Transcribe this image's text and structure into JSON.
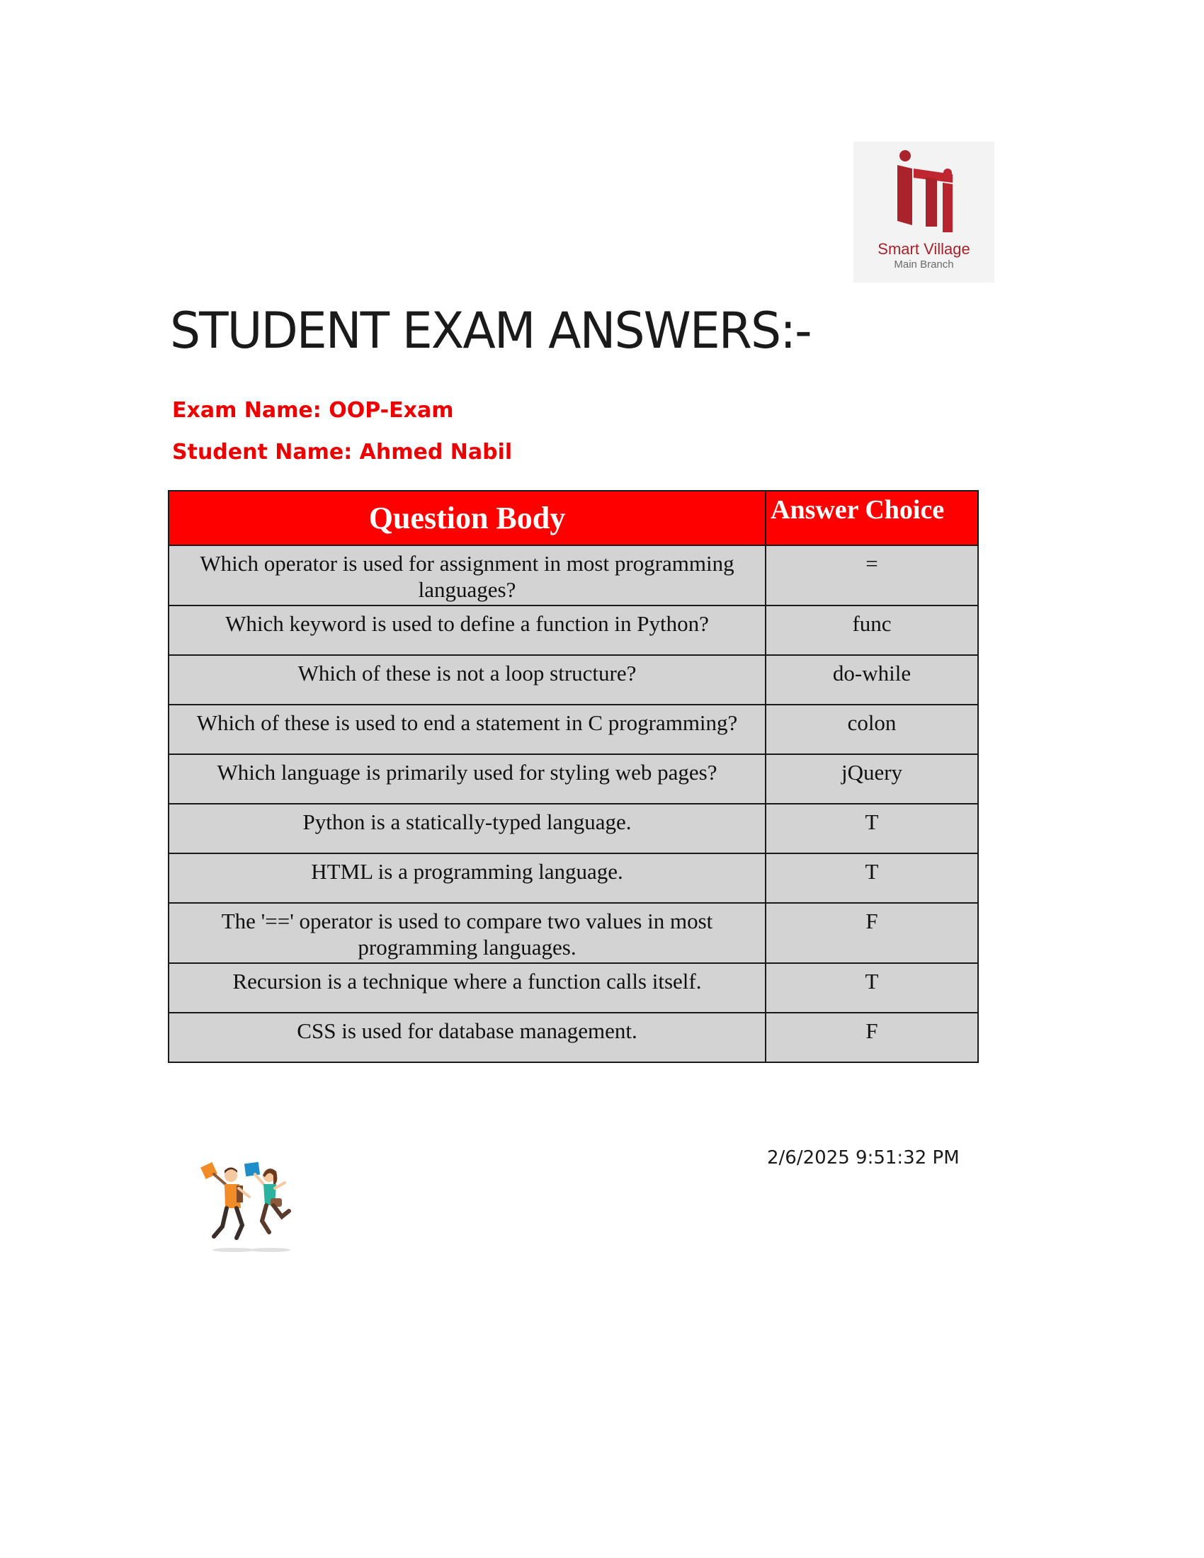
{
  "logo": {
    "title": "Smart Village",
    "subtitle": "Main Branch",
    "brand_color": "#a8232b"
  },
  "title": "STUDENT EXAM ANSWERS:-",
  "exam_name_line": "Exam Name: OOP-Exam",
  "student_name_line": "Student Name: Ahmed Nabil",
  "table": {
    "headers": [
      "Question Body",
      "Answer Choice"
    ],
    "rows": [
      {
        "question": "Which operator is used for assignment in most programming languages?",
        "answer": "="
      },
      {
        "question": "Which keyword is used to define a function in Python?",
        "answer": "func"
      },
      {
        "question": "Which of these is not a loop structure?",
        "answer": "do-while"
      },
      {
        "question": "Which of these is used to end a statement in C programming?",
        "answer": "colon"
      },
      {
        "question": "Which language is primarily used for styling web pages?",
        "answer": "jQuery"
      },
      {
        "question": "Python is a statically-typed language.",
        "answer": "T"
      },
      {
        "question": "HTML is a programming language.",
        "answer": "T"
      },
      {
        "question": "The '==' operator is used to compare two values in most programming languages.",
        "answer": "F"
      },
      {
        "question": "Recursion is a technique where a function calls itself.",
        "answer": "T"
      },
      {
        "question": "CSS is used for database management.",
        "answer": "F"
      }
    ],
    "header_color": "#ff0000",
    "cell_color": "#d3d3d3"
  },
  "timestamp": "2/6/2025 9:51:32 PM",
  "illustration": "jumping-students-illustration"
}
